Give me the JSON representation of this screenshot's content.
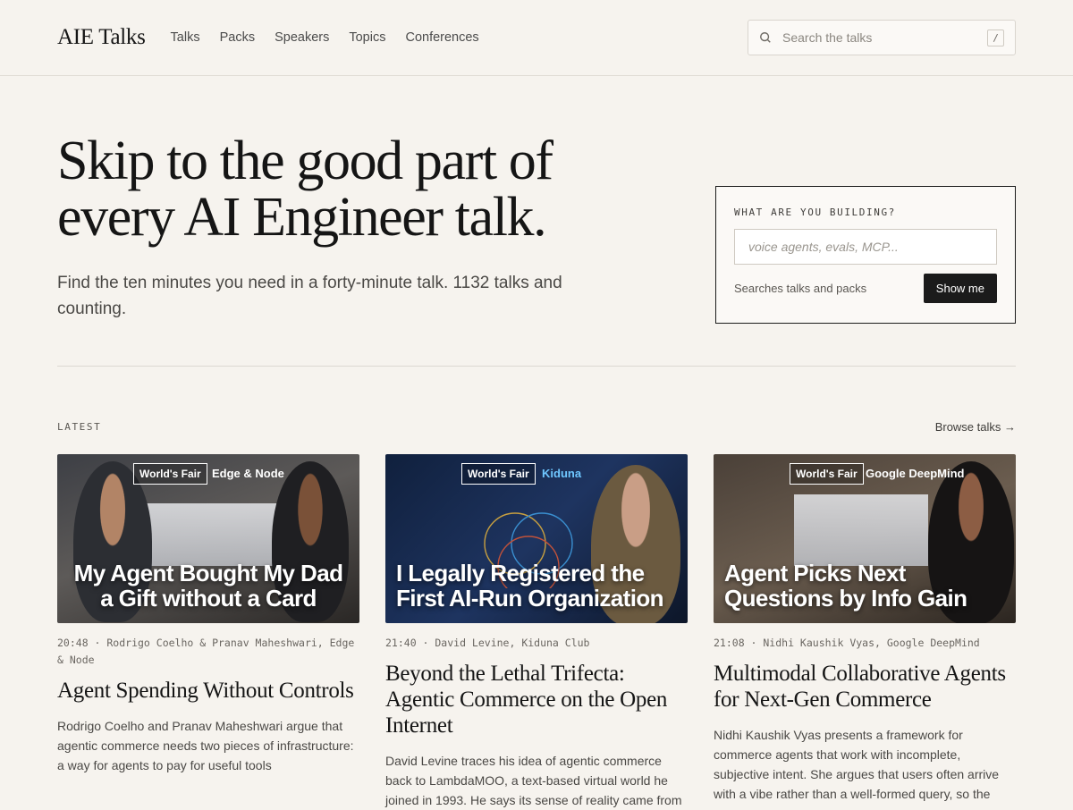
{
  "header": {
    "logo": "AIE Talks",
    "nav": [
      "Talks",
      "Packs",
      "Speakers",
      "Topics",
      "Conferences"
    ],
    "search_placeholder": "Search the talks",
    "search_shortcut": "/"
  },
  "hero": {
    "headline": "Skip to the good part of every AI Engineer talk.",
    "subhead": "Find the ten minutes you need in a forty-minute talk. 1132 talks and counting."
  },
  "builder": {
    "label": "WHAT ARE YOU BUILDING?",
    "placeholder": "voice agents, evals, MCP...",
    "hint": "Searches talks and packs",
    "button": "Show me"
  },
  "latest": {
    "label": "LATEST",
    "browse": "Browse talks →",
    "cards": [
      {
        "badge": "World's Fair",
        "partner": "Edge & Node",
        "overlay": "My Agent Bought My Dad a Gift without a Card",
        "meta": "20:48 · Rodrigo Coelho & Pranav Maheshwari, Edge & Node",
        "title": "Agent Spending Without Controls",
        "desc": "Rodrigo Coelho and Pranav Maheshwari argue that agentic commerce needs two pieces of infrastructure: a way for agents to pay for useful tools"
      },
      {
        "badge": "World's Fair",
        "partner": "Kiduna",
        "overlay": "I Legally Registered the First AI-Run Organization",
        "meta": "21:40 · David Levine, Kiduna Club",
        "title": "Beyond the Lethal Trifecta: Agentic Commerce on the Open Internet",
        "desc": "David Levine traces his idea of agentic commerce back to LambdaMOO, a text-based virtual world he joined in 1993. He says its sense of reality came from"
      },
      {
        "badge": "World's Fair",
        "partner": "Google DeepMind",
        "overlay": "Agent Picks Next Questions by Info Gain",
        "meta": "21:08 · Nidhi Kaushik Vyas, Google DeepMind",
        "title": "Multimodal Collaborative Agents for Next-Gen Commerce",
        "desc": "Nidhi Kaushik Vyas presents a framework for commerce agents that work with incomplete, subjective intent. She argues that users often arrive with a vibe rather than a well-formed query, so the"
      }
    ]
  },
  "colors": {
    "background": "#f6f3ee",
    "ink": "#1b1b1b",
    "muted": "#4a4845"
  }
}
